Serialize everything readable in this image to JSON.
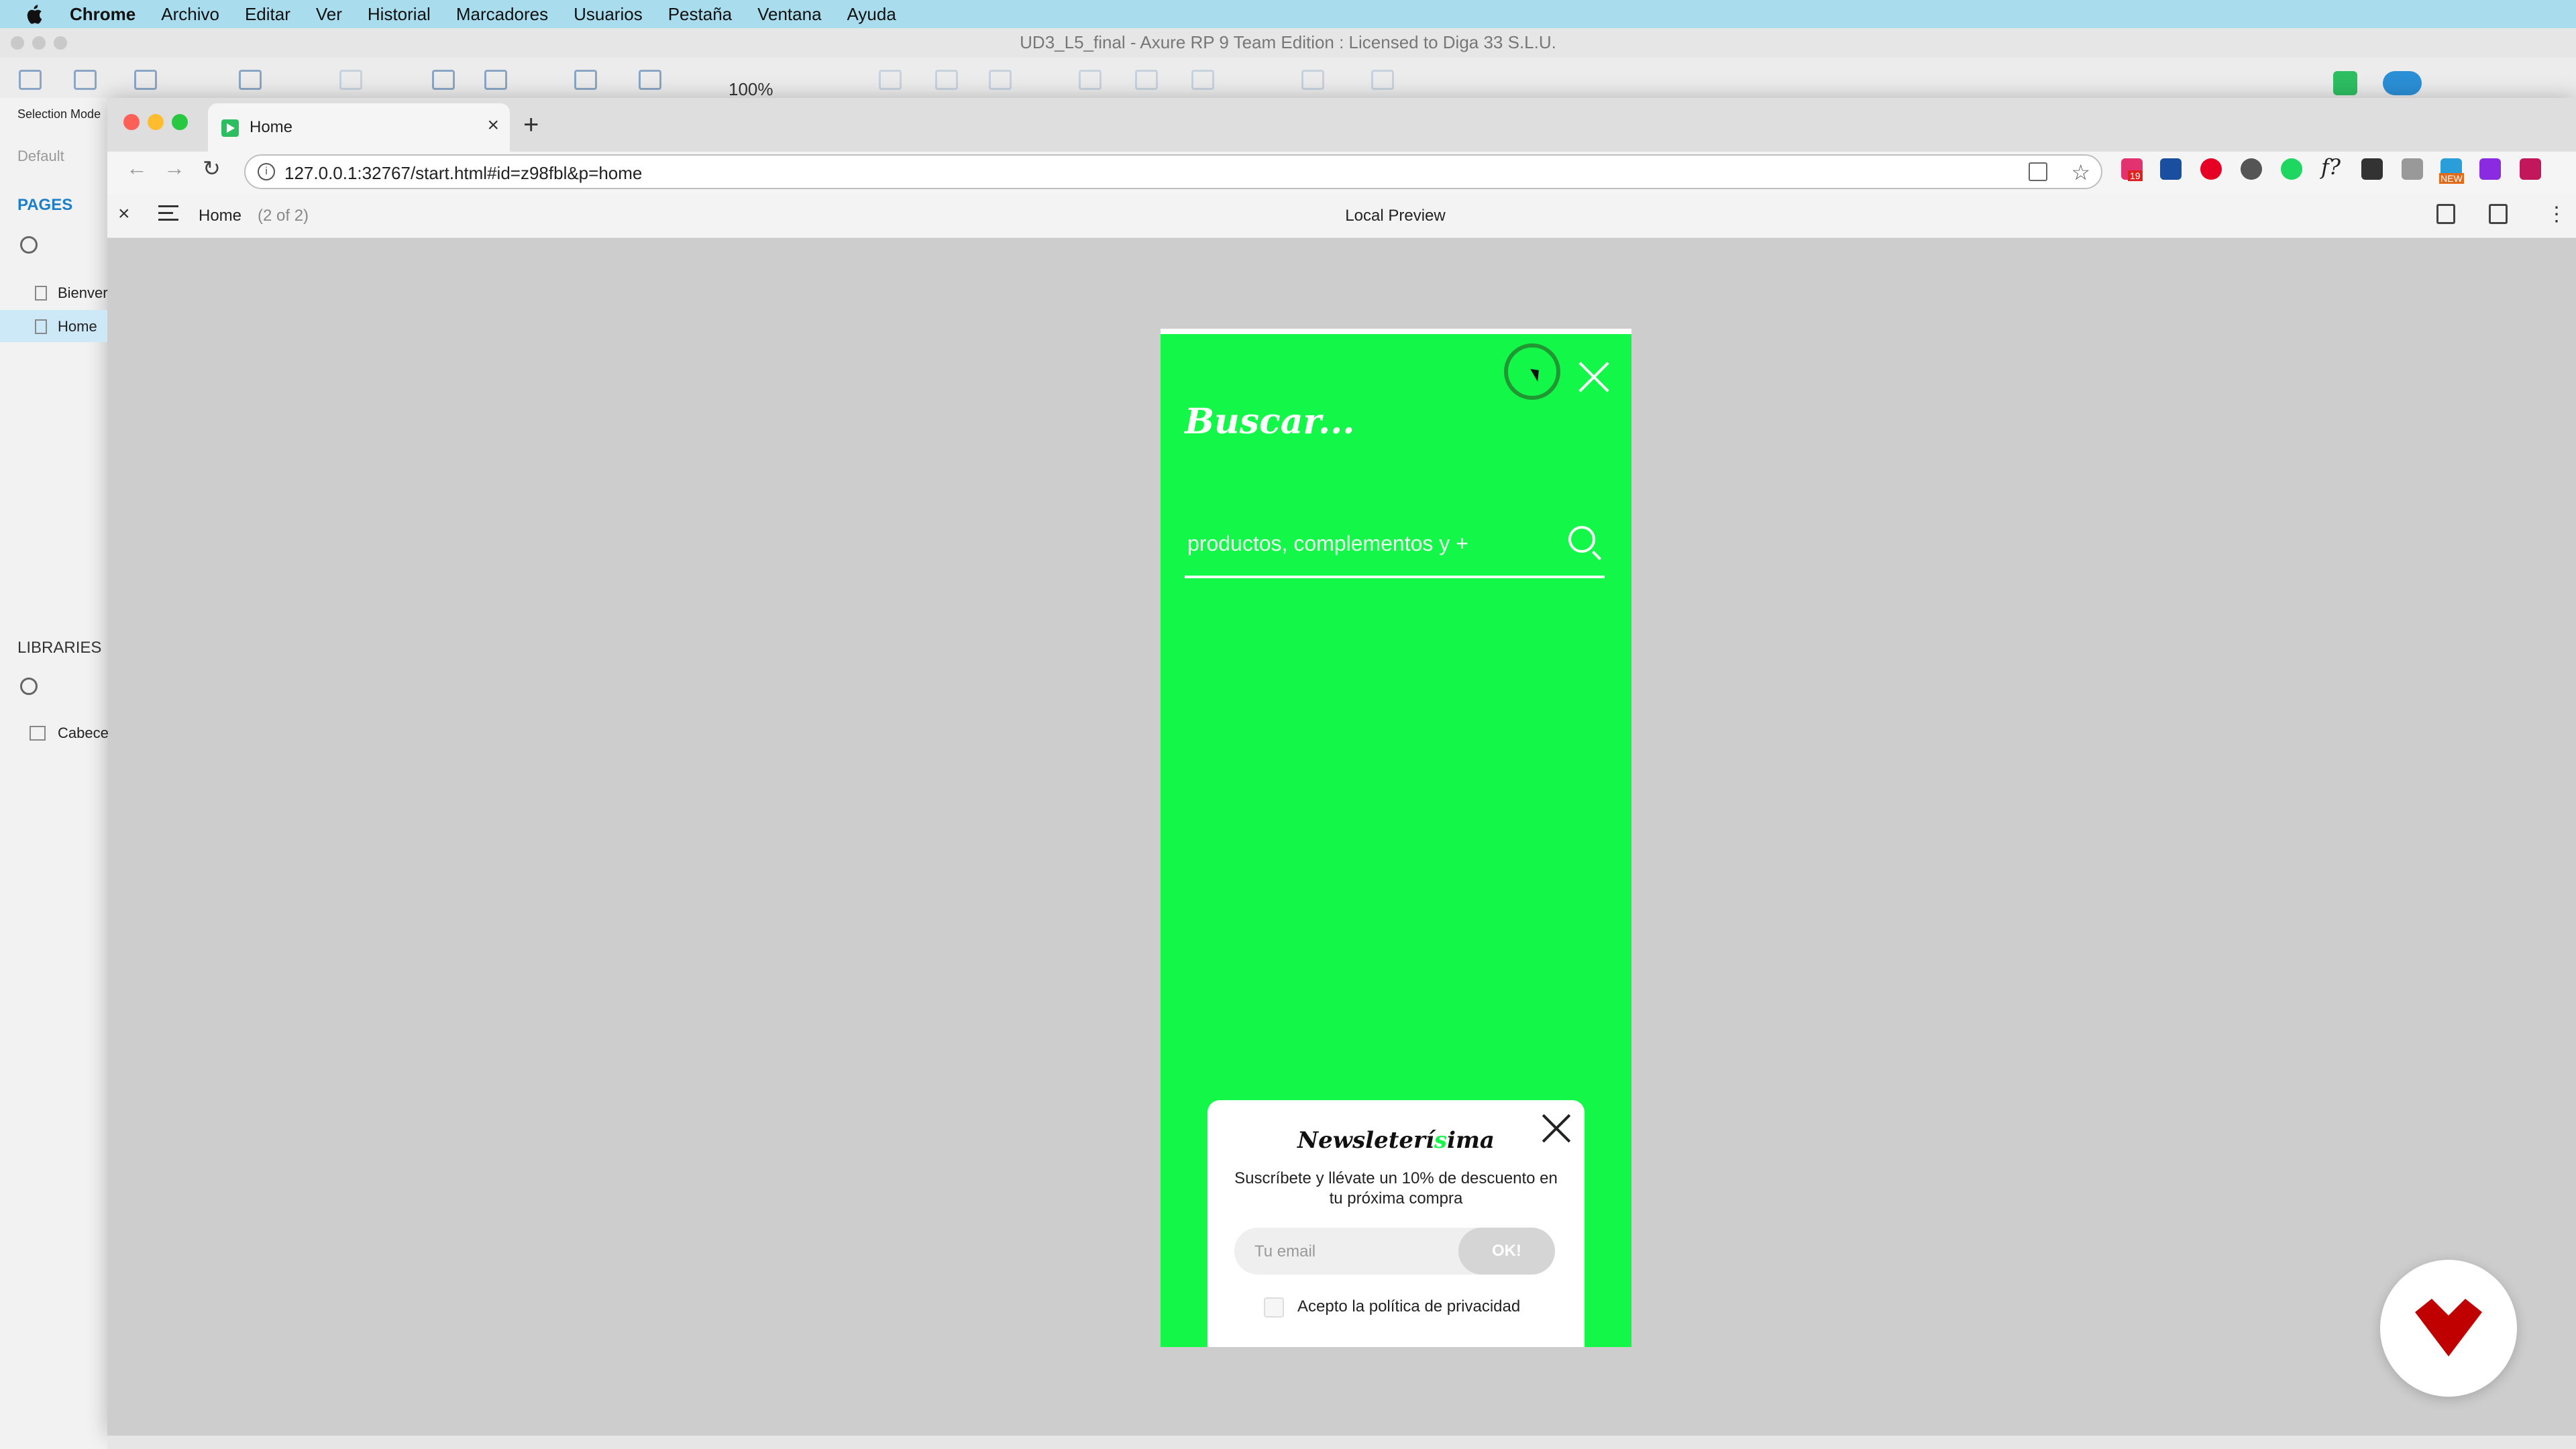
{
  "menubar": {
    "app": "Chrome",
    "items": [
      "Archivo",
      "Editar",
      "Ver",
      "Historial",
      "Marcadores",
      "Usuarios",
      "Pestaña",
      "Ventana",
      "Ayuda"
    ]
  },
  "axure": {
    "window_title": "UD3_L5_final - Axure RP 9 Team Edition : Licensed to Diga 33 S.L.U.",
    "zoom": "100%",
    "selection_mode_label": "Selection Mode",
    "style_label": "Default",
    "pages_label": "PAGES",
    "pages": [
      "Bienver",
      "Home"
    ],
    "libraries_label": "LIBRARIES",
    "library_items": [
      "Cabece"
    ]
  },
  "browser": {
    "tab_title": "Home",
    "url": "127.0.0.1:32767/start.html#id=z98fbl&p=home",
    "ext_badge": "19",
    "ext_new": "NEW"
  },
  "preview": {
    "page_name": "Home",
    "page_count": "(2 of 2)",
    "center_label": "Local Preview"
  },
  "phone": {
    "heading": "Buscar...",
    "search_placeholder": "productos, complementos y +",
    "background_color": "#13f749"
  },
  "newsletter": {
    "title_part1": "Newsleter",
    "title_accent": "í",
    "title_mid": "s",
    "title_part2": "ima",
    "subtitle": "Suscríbete y llévate un 10% de descuento en tu próxima compra",
    "email_placeholder": "Tu email",
    "ok_label": "OK!",
    "policy_label": "Acepto la política de privacidad"
  }
}
